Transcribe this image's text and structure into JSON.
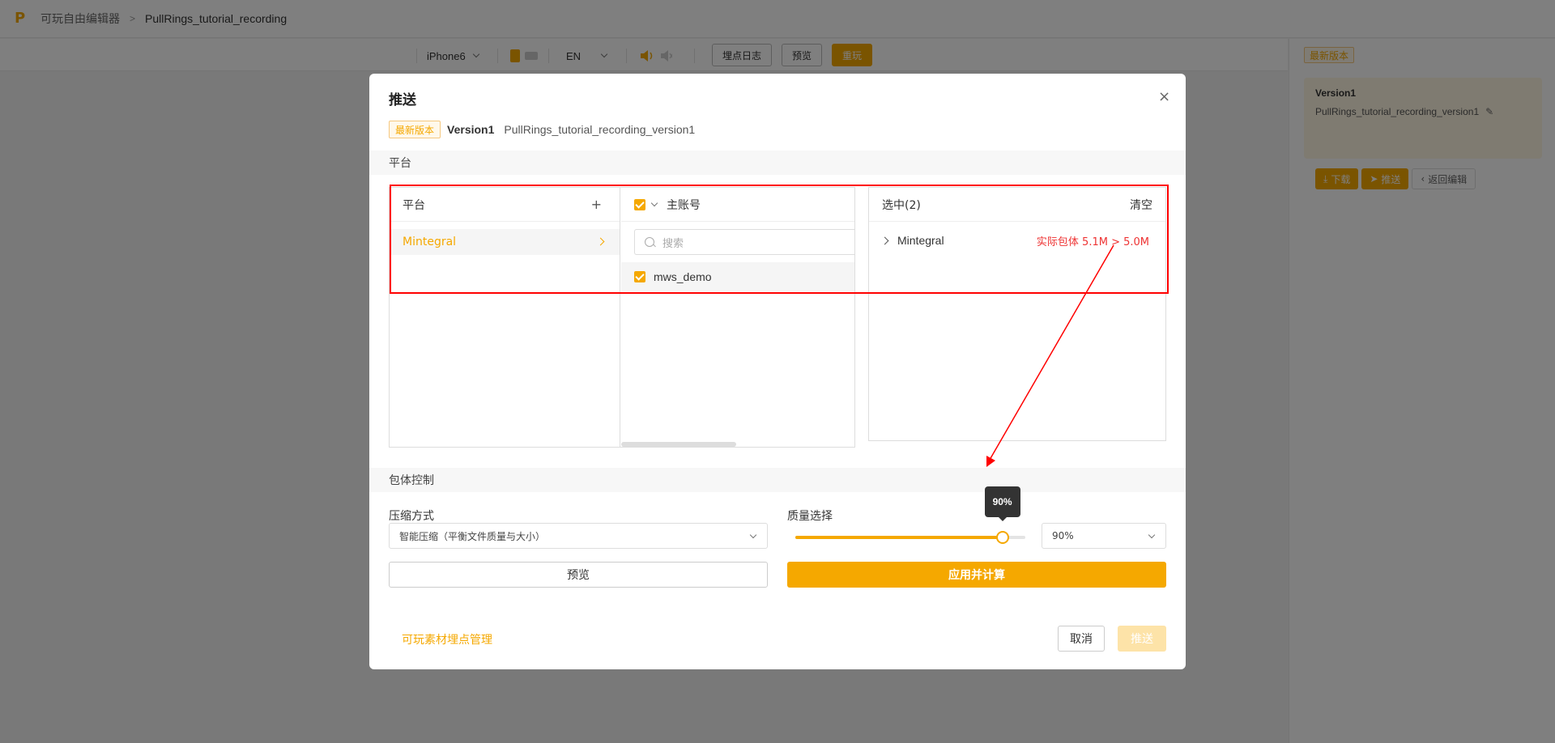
{
  "app": {
    "breadcrumb_root": "可玩自由编辑器",
    "breadcrumb_sep": ">",
    "breadcrumb_current": "PullRings_tutorial_recording",
    "accent": "#f5a800"
  },
  "toolbar": {
    "device": "iPhone6",
    "language": "EN",
    "btn_log": "埋点日志",
    "btn_preview": "预览",
    "btn_replay": "重玩"
  },
  "right_panel": {
    "tag": "最新版本",
    "version": "Version1",
    "version_name": "PullRings_tutorial_recording_version1",
    "btn_download": "下载",
    "btn_push": "推送",
    "btn_back": "返回编辑"
  },
  "modal": {
    "title": "推送",
    "close": "×",
    "tag": "最新版本",
    "version": "Version1",
    "version_name": "PullRings_tutorial_recording_version1",
    "section_platform": "平台",
    "platform_col_title": "平台",
    "platform_add": "+",
    "platform_item": "Mintegral",
    "account_col_title": "主账号",
    "search_placeholder": "搜索",
    "account_item": "mws_demo",
    "selected_title": "选中(2)",
    "clear": "清空",
    "selected_item": "Mintegral",
    "selected_warning": "实际包体 5.1M > 5.0M",
    "section_package": "包体控制",
    "compress_label": "压缩方式",
    "compress_value": "智能压缩（平衡文件质量与大小）",
    "quality_label": "质量选择",
    "quality_percent": 90,
    "quality_tooltip": "90%",
    "quality_value": "90%",
    "btn_preview": "预览",
    "btn_apply": "应用并计算",
    "link_manage": "可玩素材埋点管理",
    "btn_cancel": "取消",
    "btn_push": "推送"
  }
}
